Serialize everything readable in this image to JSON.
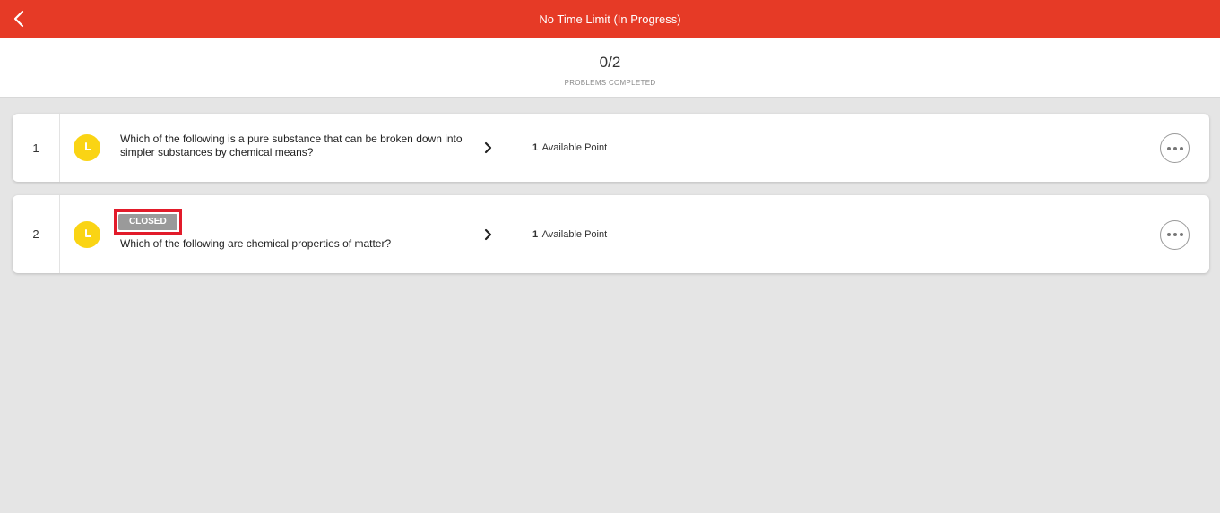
{
  "header": {
    "title": "No Time Limit (In Progress)",
    "back_icon": "chevron-left-icon",
    "bg_color": "#e63a26"
  },
  "progress": {
    "count": "0/2",
    "label": "PROBLEMS COMPLETED"
  },
  "problems": [
    {
      "number": "1",
      "status_icon": "clock-icon",
      "badge": "",
      "question": "Which of the following is a pure substance that can be broken down into simpler substances by chemical means?",
      "points_value": "1",
      "points_label": "Available Point"
    },
    {
      "number": "2",
      "status_icon": "clock-icon",
      "badge": "CLOSED",
      "question": "Which of the following are chemical properties of matter?",
      "points_value": "1",
      "points_label": "Available Point"
    }
  ],
  "colors": {
    "accent": "#e63a26",
    "clock": "#fad414",
    "badge_bg": "#9a9a9a",
    "highlight_outline": "#e21b2a"
  }
}
